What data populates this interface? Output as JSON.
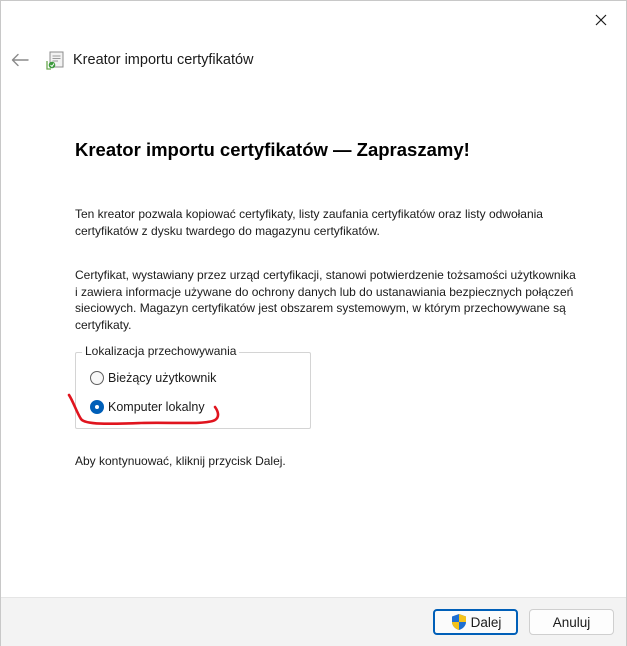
{
  "window": {
    "title": "Kreator importu certyfikatów"
  },
  "header": {
    "back_icon": "arrow-left-icon",
    "app_icon": "certificate-wizard-icon",
    "close_icon": "close-icon"
  },
  "main": {
    "heading": "Kreator importu certyfikatów — Zapraszamy!",
    "paragraph1": "Ten kreator pozwala kopiować certyfikaty, listy zaufania certyfikatów oraz listy odwołania certyfikatów z dysku twardego do magazynu certyfikatów.",
    "paragraph2": "Certyfikat, wystawiany przez urząd certyfikacji, stanowi potwierdzenie tożsamości użytkownika i zawiera informacje używane do ochrony danych lub do ustanawiania bezpiecznych połączeń sieciowych. Magazyn certyfikatów jest obszarem systemowym, w którym przechowywane są certyfikaty.",
    "store_location": {
      "legend": "Lokalizacja przechowywania",
      "options": [
        {
          "label": "Bieżący użytkownik",
          "checked": false
        },
        {
          "label": "Komputer lokalny",
          "checked": true
        }
      ]
    },
    "paragraph3": "Aby kontynuować, kliknij przycisk Dalej."
  },
  "footer": {
    "next_label": "Dalej",
    "next_icon": "uac-shield-icon",
    "cancel_label": "Anuluj"
  },
  "colors": {
    "accent": "#005fb8",
    "annotation": "#e0141e",
    "footer_bg": "#f3f3f3"
  }
}
